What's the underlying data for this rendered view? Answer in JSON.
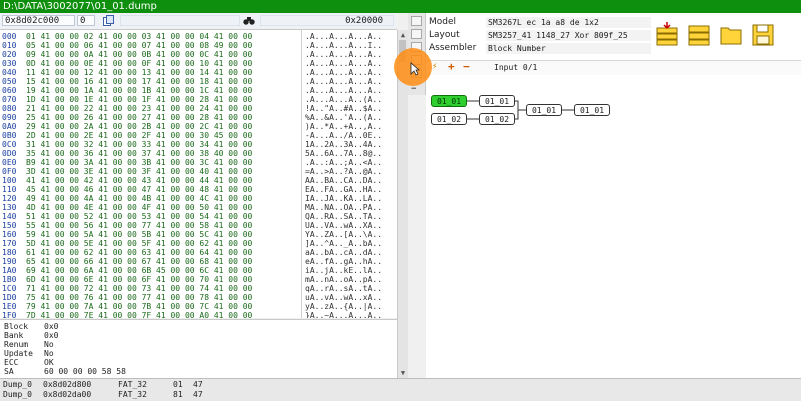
{
  "window": {
    "title": "D:\\DATA\\3002077\\01_01.dump"
  },
  "toolbar": {
    "address": "0x8d02c000",
    "zero": "0",
    "size": "0x20000"
  },
  "hex": {
    "rows": [
      {
        "a": "000",
        "b": "01 41 00 00 02 41 00 00 03 41 00 00 04 41 00 00",
        "t": ".A...A...A...A.."
      },
      {
        "a": "010",
        "b": "05 41 00 00 06 41 00 00 07 41 00 00 08 49 00 00",
        "t": ".A...A...A...I.."
      },
      {
        "a": "020",
        "b": "09 41 00 00 0A 41 00 00 0B 41 00 00 0C 41 00 00",
        "t": ".A...A...A...A.."
      },
      {
        "a": "030",
        "b": "0D 41 00 00 0E 41 00 00 0F 41 00 00 10 41 00 00",
        "t": ".A...A...A...A.."
      },
      {
        "a": "040",
        "b": "11 41 00 00 12 41 00 00 13 41 00 00 14 41 00 00",
        "t": ".A...A...A...A.."
      },
      {
        "a": "050",
        "b": "15 41 00 00 16 41 00 00 17 41 00 00 18 41 00 00",
        "t": ".A...A...A...A.."
      },
      {
        "a": "060",
        "b": "19 41 00 00 1A 41 00 00 1B 41 00 00 1C 41 00 00",
        "t": ".A...A...A...A.."
      },
      {
        "a": "070",
        "b": "1D 41 00 00 1E 41 00 00 1F 41 00 00 28 41 00 00",
        "t": ".A...A...A..(A.."
      },
      {
        "a": "080",
        "b": "21 41 00 00 22 41 00 00 23 41 00 00 24 41 00 00",
        "t": "!A..\"A..#A..$A.."
      },
      {
        "a": "090",
        "b": "25 41 00 00 26 41 00 00 27 41 00 00 28 41 00 00",
        "t": "%A..&A..'A..(A.."
      },
      {
        "a": "0A0",
        "b": "29 41 00 00 2A 41 00 00 2B 41 00 00 2C 41 00 00",
        "t": ")A..*A..+A..,A.."
      },
      {
        "a": "0B0",
        "b": "2D 41 00 00 2E 41 00 00 2F 41 00 00 30 45 00 00",
        "t": "-A...A../A..0E.."
      },
      {
        "a": "0C0",
        "b": "31 41 00 00 32 41 00 00 33 41 00 00 34 41 00 00",
        "t": "1A..2A..3A..4A.."
      },
      {
        "a": "0D0",
        "b": "35 41 00 00 36 41 00 00 37 41 00 00 38 40 00 00",
        "t": "5A..6A..7A..8@.."
      },
      {
        "a": "0E0",
        "b": "B9 41 00 00 3A 41 00 00 3B 41 00 00 3C 41 00 00",
        "t": ".A..:A..;A..<A.."
      },
      {
        "a": "0F0",
        "b": "3D 41 00 00 3E 41 00 00 3F 41 00 00 40 41 00 00",
        "t": "=A..>A..?A..@A.."
      },
      {
        "a": "100",
        "b": "41 41 00 00 42 41 00 00 43 41 00 00 44 41 00 00",
        "t": "AA..BA..CA..DA.."
      },
      {
        "a": "110",
        "b": "45 41 00 00 46 41 00 00 47 41 00 00 48 41 00 00",
        "t": "EA..FA..GA..HA.."
      },
      {
        "a": "120",
        "b": "49 41 00 00 4A 41 00 00 4B 41 00 00 4C 41 00 00",
        "t": "IA..JA..KA..LA.."
      },
      {
        "a": "130",
        "b": "4D 41 00 00 4E 41 00 00 4F 41 00 00 50 41 00 00",
        "t": "MA..NA..OA..PA.."
      },
      {
        "a": "140",
        "b": "51 41 00 00 52 41 00 00 53 41 00 00 54 41 00 00",
        "t": "QA..RA..SA..TA.."
      },
      {
        "a": "150",
        "b": "55 41 00 00 56 41 00 00 77 41 00 00 58 41 00 00",
        "t": "UA..VA..wA..XA.."
      },
      {
        "a": "160",
        "b": "59 41 00 00 5A 41 00 00 5B 41 00 00 5C 41 00 00",
        "t": "YA..ZA..[A..\\A.."
      },
      {
        "a": "170",
        "b": "5D 41 00 00 5E 41 00 00 5F 41 00 00 62 41 00 00",
        "t": "]A..^A.._A..bA.."
      },
      {
        "a": "180",
        "b": "61 41 00 00 62 41 00 00 63 41 00 00 64 41 00 00",
        "t": "aA..bA..cA..dA.."
      },
      {
        "a": "190",
        "b": "65 41 00 00 66 41 00 00 67 41 00 00 68 41 00 00",
        "t": "eA..fA..gA..hA.."
      },
      {
        "a": "1A0",
        "b": "69 41 00 00 6A 41 00 00 6B 45 00 00 6C 41 00 00",
        "t": "iA..jA..kE..lA.."
      },
      {
        "a": "1B0",
        "b": "6D 41 00 00 6E 41 00 00 6F 41 00 00 70 41 00 00",
        "t": "mA..nA..oA..pA.."
      },
      {
        "a": "1C0",
        "b": "71 41 00 00 72 41 00 00 73 41 00 00 74 41 00 00",
        "t": "qA..rA..sA..tA.."
      },
      {
        "a": "1D0",
        "b": "75 41 00 00 76 41 00 00 77 41 00 00 78 41 00 00",
        "t": "uA..vA..wA..xA.."
      },
      {
        "a": "1E0",
        "b": "79 41 00 00 7A 41 00 00 7B 41 00 00 7C 41 00 00",
        "t": "yA..zA..{A..|A.."
      },
      {
        "a": "1F0",
        "b": "7D 41 00 00 7E 41 00 00 7F 41 00 00 A0 41 00 00",
        "t": "}A..~A...A...A.."
      }
    ]
  },
  "info": [
    {
      "label": "Block",
      "value": "0x0"
    },
    {
      "label": "Bank",
      "value": "0x0"
    },
    {
      "label": "Renum",
      "value": "No"
    },
    {
      "label": "Update",
      "value": "No"
    },
    {
      "label": "ECC",
      "value": "OK"
    },
    {
      "label": "SA",
      "value": "60 00 00 00 58 58"
    }
  ],
  "meta": {
    "model_label": "Model",
    "model_value": "SM3267L  ec 1a a8 de  1x2",
    "layout_label": "Layout",
    "layout_value": "SM3257_41 1148_27 Xor 809f_25",
    "assembler_label": "Assembler",
    "assembler_value": "Block Number"
  },
  "subtoolbar": {
    "input_label": "Input 0/1"
  },
  "nodes": [
    {
      "label": "01_01"
    },
    {
      "label": "01_01"
    },
    {
      "label": "01_02"
    },
    {
      "label": "01_02"
    },
    {
      "label": "01_01"
    },
    {
      "label": "01_01"
    }
  ],
  "status": [
    {
      "name": "Dump_0",
      "addr": "0x8d02d800",
      "fs": "FAT_32",
      "a": "01",
      "b": "47"
    },
    {
      "name": "Dump_0",
      "addr": "0x8d02da00",
      "fs": "FAT_32",
      "a": "81",
      "b": "47"
    }
  ],
  "colors": {
    "titlebar": "#0e8f0e",
    "active_node": "#2fcf2f",
    "cursor": "#ff8c14"
  }
}
